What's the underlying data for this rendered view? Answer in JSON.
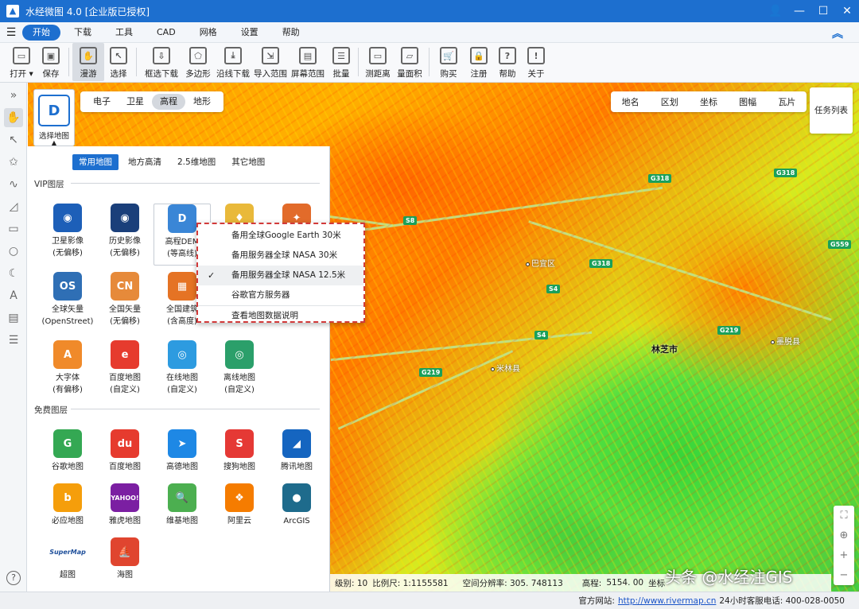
{
  "window": {
    "title": "水经微图 4.0 [企业版已授权]"
  },
  "menu": {
    "items": [
      "开始",
      "下载",
      "工具",
      "CAD",
      "网格",
      "设置",
      "帮助"
    ],
    "active": "开始"
  },
  "toolbar": {
    "items": [
      {
        "label": "打开 ▾",
        "icon": "folder-icon"
      },
      {
        "label": "保存",
        "icon": "save-icon"
      },
      {
        "label": "漫游",
        "icon": "hand-icon"
      },
      {
        "label": "选择",
        "icon": "cursor-icon"
      },
      {
        "label": "框选下载",
        "icon": "box-download-icon"
      },
      {
        "label": "多边形",
        "icon": "polygon-icon"
      },
      {
        "label": "沿线下载",
        "icon": "line-download-icon"
      },
      {
        "label": "导入范围",
        "icon": "import-icon"
      },
      {
        "label": "屏幕范围",
        "icon": "screen-icon"
      },
      {
        "label": "批量",
        "icon": "batch-icon"
      },
      {
        "label": "测距离",
        "icon": "ruler-icon"
      },
      {
        "label": "量面积",
        "icon": "area-icon"
      },
      {
        "label": "购买",
        "icon": "cart-icon"
      },
      {
        "label": "注册",
        "icon": "lock-icon"
      },
      {
        "label": "帮助",
        "icon": "help-icon"
      },
      {
        "label": "关于",
        "icon": "info-icon"
      }
    ]
  },
  "map_tabs": [
    "电子",
    "卫星",
    "高程",
    "地形"
  ],
  "map_tabs_active": "高程",
  "right_tabs": [
    "地名",
    "区划",
    "坐标",
    "图幅",
    "瓦片"
  ],
  "task_list": "任务列表",
  "select_map": "选择地图",
  "panel": {
    "subtabs": [
      "常用地图",
      "地方高清",
      "2.5维地图",
      "其它地图"
    ],
    "vip_title": "VIP图层",
    "free_title": "免费图层",
    "vip": [
      {
        "l1": "卫星影像",
        "l2": "(无偏移)",
        "color": "#1d5fb8",
        "sym": "◉"
      },
      {
        "l1": "历史影像",
        "l2": "(无偏移)",
        "color": "#1a3f7a",
        "sym": "◉"
      },
      {
        "l1": "高程DEM",
        "l2": "(等高线)",
        "color": "#3a86d6",
        "sym": "D"
      },
      {
        "l1": "",
        "l2": "",
        "color": "#e9b93a",
        "sym": "♦"
      },
      {
        "l1": "",
        "l2": "",
        "color": "#e26b2a",
        "sym": "✦"
      },
      {
        "l1": "全球矢量",
        "l2": "(OpenStreet)",
        "color": "#2f6fb5",
        "sym": "OS"
      },
      {
        "l1": "全国矢量",
        "l2": "(无偏移)",
        "color": "#e68a3a",
        "sym": "CN"
      },
      {
        "l1": "全国建筑",
        "l2": "(含高度)",
        "color": "#e57324",
        "sym": "▦"
      },
      {
        "l1": "",
        "l2": "",
        "color": "#ffffff",
        "sym": ""
      },
      {
        "l1": "",
        "l2": "",
        "color": "#ffffff",
        "sym": ""
      },
      {
        "l1": "大字体",
        "l2": "(有偏移)",
        "color": "#f08a2a",
        "sym": "A"
      },
      {
        "l1": "百度地图",
        "l2": "(自定义)",
        "color": "#e63b2e",
        "sym": "e"
      },
      {
        "l1": "在线地图",
        "l2": "(自定义)",
        "color": "#2d9be0",
        "sym": "◎"
      },
      {
        "l1": "离线地图",
        "l2": "(自定义)",
        "color": "#2b9f6a",
        "sym": "◎"
      }
    ],
    "free": [
      {
        "l1": "谷歌地图",
        "color": "#34a853",
        "sym": "G"
      },
      {
        "l1": "百度地图",
        "color": "#e63b2e",
        "sym": "du"
      },
      {
        "l1": "高德地图",
        "color": "#1e88e5",
        "sym": "➤"
      },
      {
        "l1": "搜狗地图",
        "color": "#e53935",
        "sym": "S"
      },
      {
        "l1": "腾讯地图",
        "color": "#1565c0",
        "sym": "◢"
      },
      {
        "l1": "必应地图",
        "color": "#f59e0b",
        "sym": "b"
      },
      {
        "l1": "雅虎地图",
        "color": "#7b1fa2",
        "sym": "YAHOO!"
      },
      {
        "l1": "维基地图",
        "color": "#4caf50",
        "sym": "🔍"
      },
      {
        "l1": "阿里云",
        "color": "#f57c00",
        "sym": "❖"
      },
      {
        "l1": "ArcGIS",
        "color": "#1e6b8c",
        "sym": "●"
      },
      {
        "l1": "超图",
        "color": "#ffffff",
        "sym": "SuperMap"
      },
      {
        "l1": "海图",
        "color": "#e0452f",
        "sym": "⛵"
      }
    ]
  },
  "context_menu": {
    "items": [
      "备用全球Google Earth 30米",
      "备用服务器全球 NASA 30米",
      "备用服务器全球 NASA 12.5米",
      "谷歌官方服务器",
      "查看地图数据说明"
    ],
    "checked": 2
  },
  "map_labels": {
    "roads": [
      "S8",
      "G318",
      "G318",
      "G318",
      "S4",
      "S4",
      "G219",
      "G219",
      "G559"
    ],
    "cities": [
      "巴宜区",
      "米林县",
      "墨脱县"
    ],
    "main_city": "林芝市"
  },
  "status": {
    "level": "级别: 10",
    "scale": "比例尺: 1:1155581",
    "resolution": "空间分辨率: 305. 748113",
    "elevation": "高程:",
    "elevation_value": "5154. 00",
    "coord": "坐标"
  },
  "watermark": "头条 @水经注GIS",
  "footer": {
    "site_label": "官方网站:",
    "site": "http://www.rivermap.cn",
    "hotline": "24小时客服电话: 400-028-0050"
  },
  "colors": {
    "accent": "#1d6fcf",
    "menu_highlight": "#d23a3a"
  }
}
